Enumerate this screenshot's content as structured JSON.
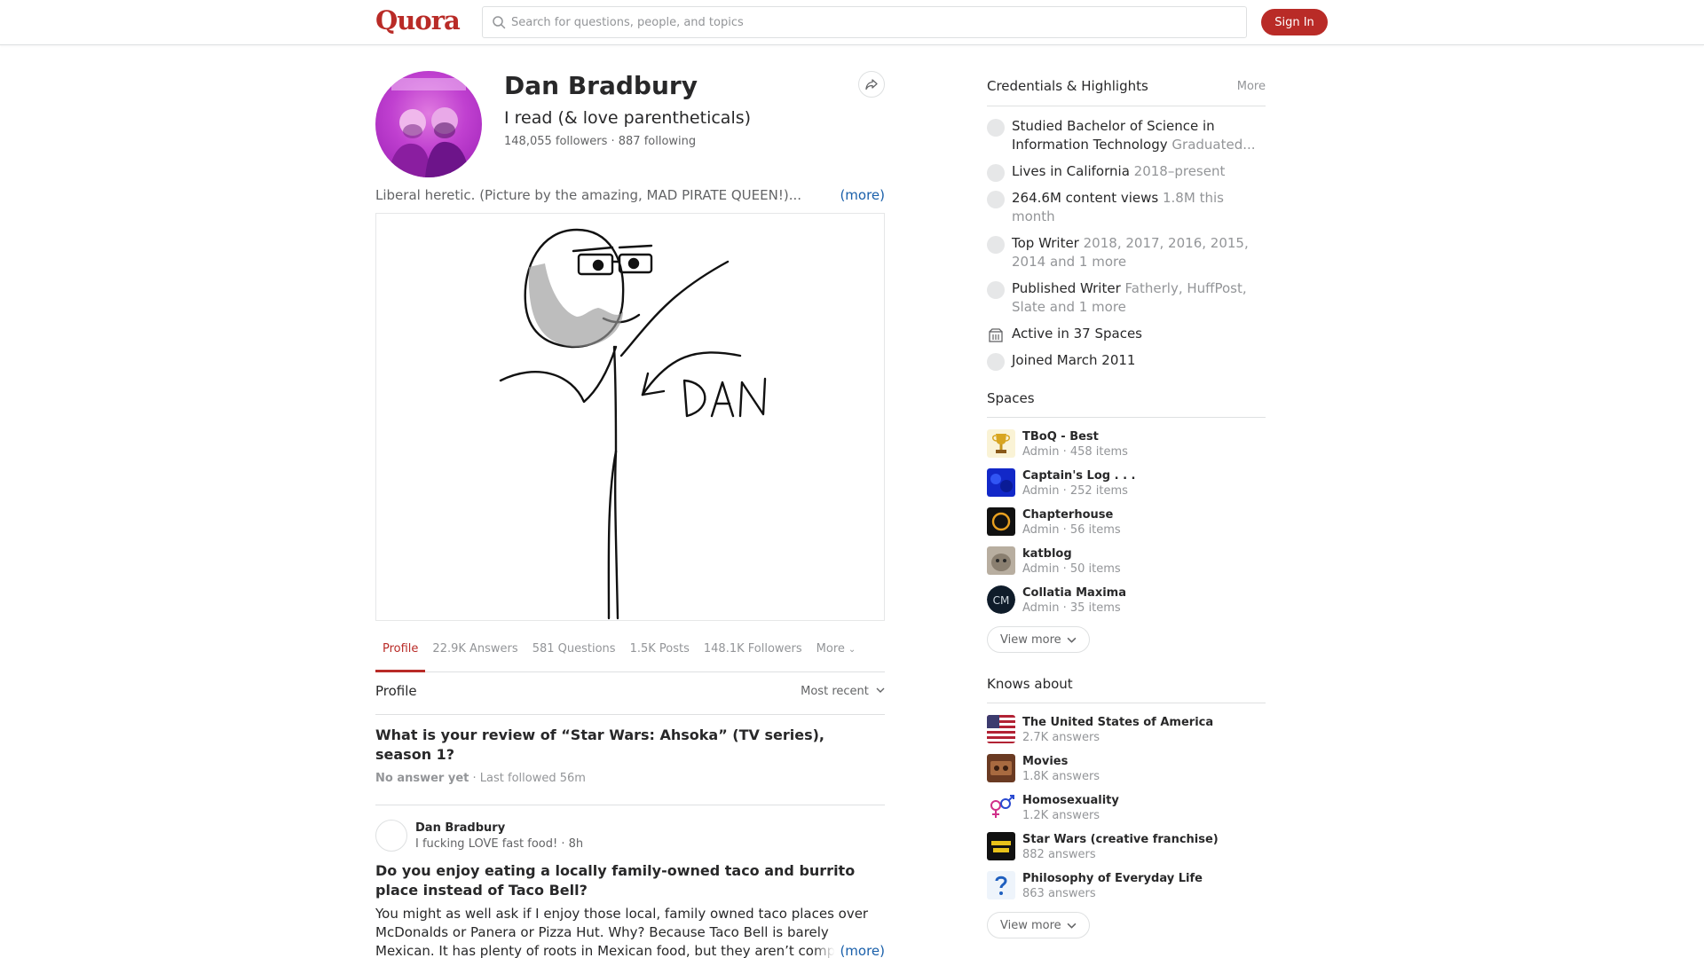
{
  "header": {
    "logo": "Quora",
    "search_placeholder": "Search for questions, people, and topics",
    "signin_label": "Sign In"
  },
  "profile": {
    "name": "Dan Bradbury",
    "tagline": "I read (& love parentheticals)",
    "stats": "148,055 followers · 887 following",
    "bio": "Liberal heretic. (Picture by the amazing, MAD PIRATE QUEEN!)...",
    "bio_more": "(more)"
  },
  "tabs": [
    {
      "label": "Profile"
    },
    {
      "label": "22.9K Answers"
    },
    {
      "label": "581 Questions"
    },
    {
      "label": "1.5K Posts"
    },
    {
      "label": "148.1K Followers"
    },
    {
      "label": "More"
    }
  ],
  "feed": {
    "section_title": "Profile",
    "sort_label": "Most recent",
    "question": {
      "title": "What is your review of “Star Wars: Ahsoka” (TV series), season 1?",
      "status": "No answer yet",
      "followed": "· Last followed 56m"
    },
    "post": {
      "author": "Dan Bradbury",
      "credential": "I fucking LOVE fast food! · 8h",
      "question": "Do you enjoy eating a locally family-owned taco and burrito place instead of Taco Bell?",
      "body": "You might as well ask if I enjoy those local, family owned taco places over McDonalds or Panera or Pizza Hut. Why? Because Taco Bell is barely Mexican. It has plenty of roots in Mexican food, but they aren’t comp",
      "more": "(more)"
    }
  },
  "credentials": {
    "title": "Credentials & Highlights",
    "more": "More",
    "items": [
      {
        "main": "Studied Bachelor of Science in Information Technology",
        "sub": "Graduated...",
        "icon": "education-icon"
      },
      {
        "main": "Lives in California",
        "sub": "2018–present",
        "icon": "location-icon"
      },
      {
        "main": "264.6M content views",
        "sub": "1.8M this month",
        "icon": "views-icon"
      },
      {
        "main": "Top Writer",
        "sub": "2018, 2017, 2016, 2015, 2014 and 1 more",
        "icon": "top-writer-icon"
      },
      {
        "main": "Published Writer",
        "sub": "Fatherly, HuffPost, Slate and 1 more",
        "icon": "published-icon"
      },
      {
        "main": "Active in 37 Spaces",
        "sub": "",
        "icon": "spaces-icon"
      },
      {
        "main": "Joined March 2011",
        "sub": "",
        "icon": "joined-icon"
      }
    ]
  },
  "spaces": {
    "title": "Spaces",
    "items": [
      {
        "name": "TBoQ - Best",
        "sub": "Admin · 458 items",
        "color": "#f4e7b6"
      },
      {
        "name": "Captain's Log . . .",
        "sub": "Admin · 252 items",
        "color": "#1a2ad8"
      },
      {
        "name": "Chapterhouse",
        "sub": "Admin · 56 items",
        "color": "#111111"
      },
      {
        "name": "katblog",
        "sub": "Admin · 50 items",
        "color": "#8f857a"
      },
      {
        "name": "Collatia Maxima",
        "sub": "Admin · 35 items",
        "color": "#0f1c2a"
      }
    ],
    "view_more": "View more"
  },
  "knows_about": {
    "title": "Knows about",
    "items": [
      {
        "name": "The United States of America",
        "sub": "2.7K answers"
      },
      {
        "name": "Movies",
        "sub": "1.8K answers"
      },
      {
        "name": "Homosexuality",
        "sub": "1.2K answers"
      },
      {
        "name": "Star Wars (creative franchise)",
        "sub": "882 answers"
      },
      {
        "name": "Philosophy of Everyday Life",
        "sub": "863 answers"
      }
    ],
    "view_more": "View more"
  }
}
